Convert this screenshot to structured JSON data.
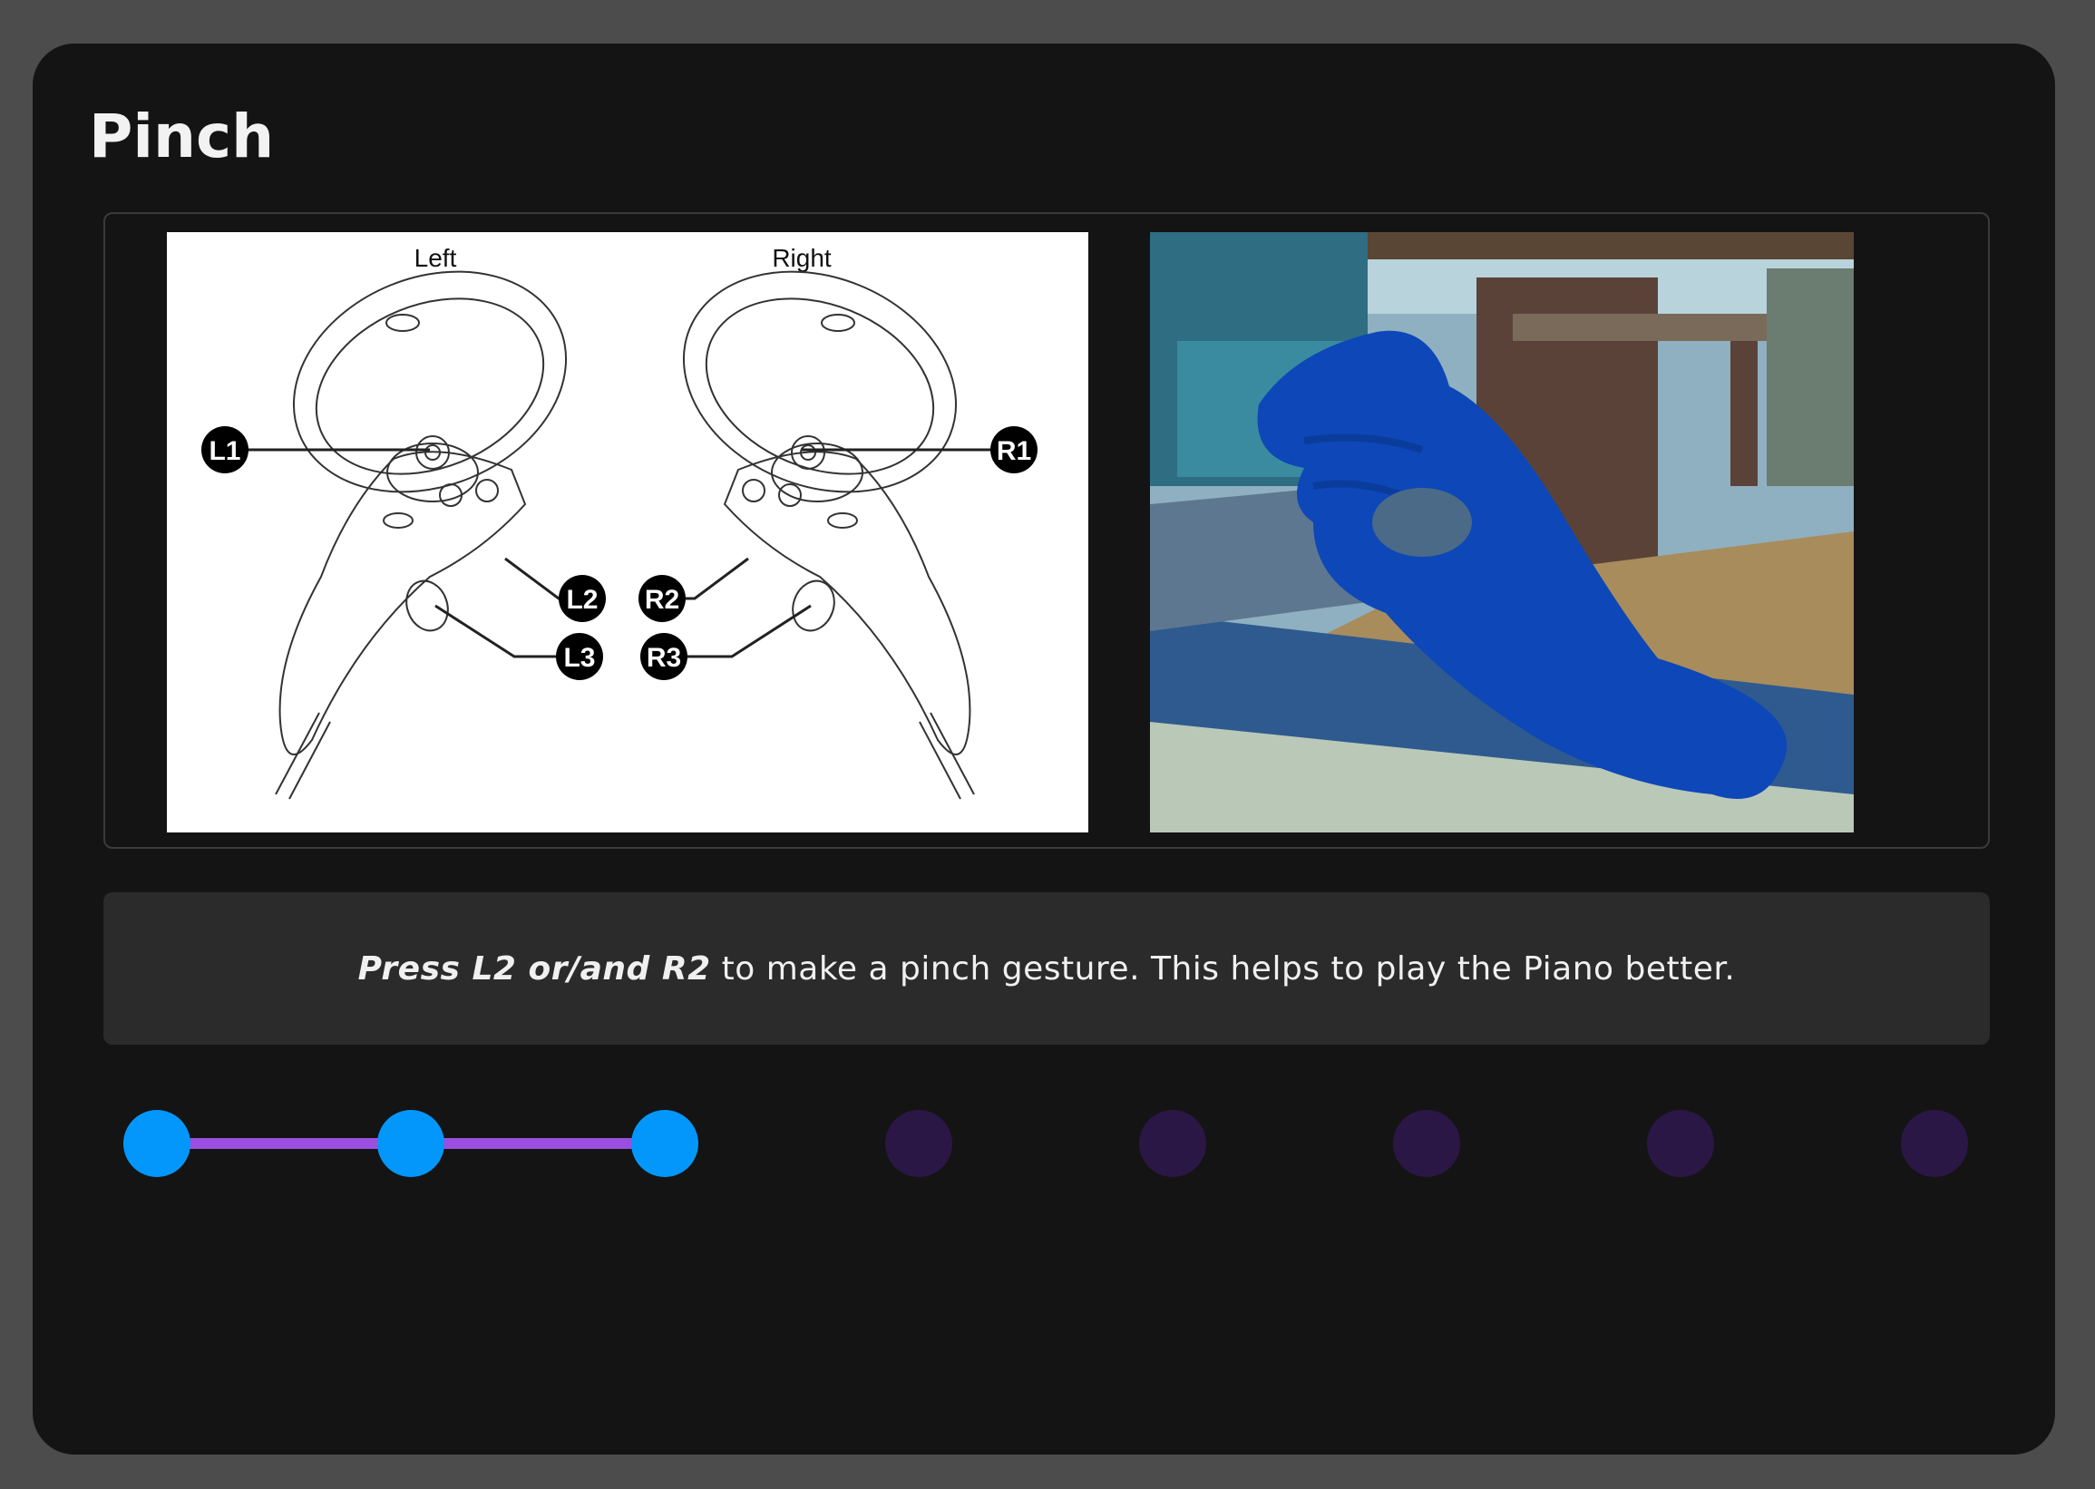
{
  "window": {
    "title": "Pinch"
  },
  "diagram": {
    "left_label": "Left",
    "right_label": "Right",
    "callouts": [
      "L1",
      "L2",
      "L3",
      "R1",
      "R2",
      "R3"
    ]
  },
  "scene": {
    "icon": "pinch-hand-scene"
  },
  "instruction": {
    "emphasis": "Press L2 or/and R2",
    "text": "to make a pinch gesture. This helps to play the Piano better."
  },
  "stepper": {
    "total_steps": 8,
    "current_step": 3,
    "colors": {
      "done": "#0497fb",
      "todo": "#2b1746",
      "line": "#9a4fe0"
    }
  }
}
